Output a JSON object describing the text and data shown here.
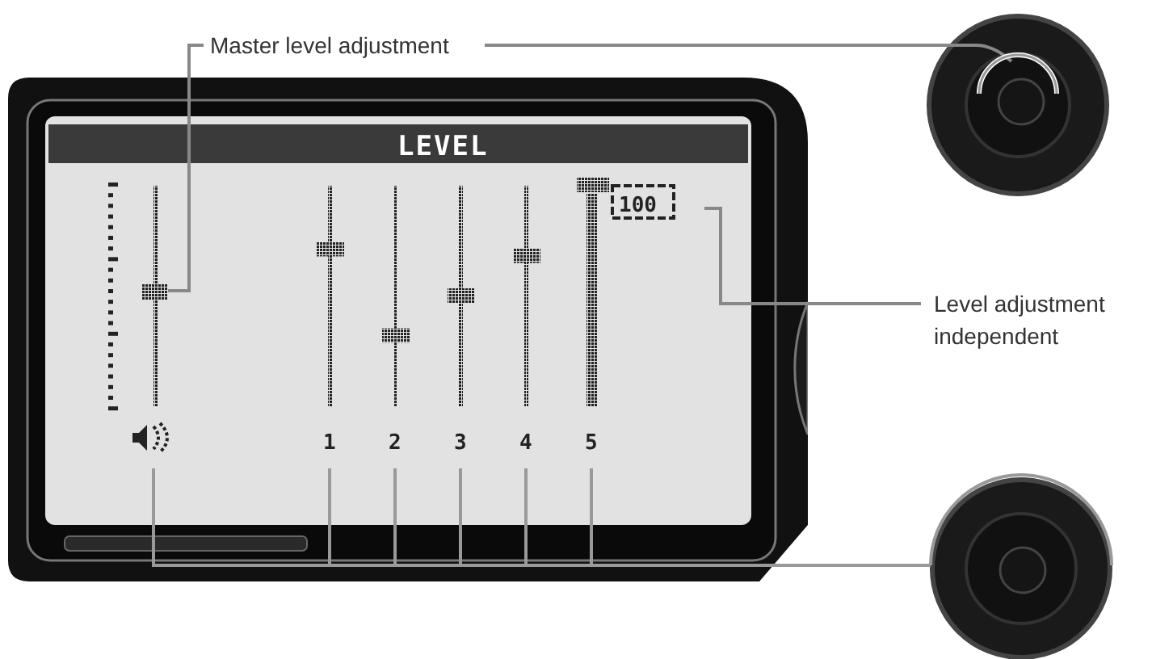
{
  "screen": {
    "title": "LEVEL"
  },
  "master": {
    "level": 0.52
  },
  "channels": [
    {
      "label": "1",
      "level": 0.71,
      "selected": false
    },
    {
      "label": "2",
      "level": 0.32,
      "selected": false
    },
    {
      "label": "3",
      "level": 0.5,
      "selected": false
    },
    {
      "label": "4",
      "level": 0.68,
      "selected": false
    },
    {
      "label": "5",
      "level": 1,
      "selected": true,
      "reading": "100"
    }
  ],
  "callouts": {
    "master": "Master level adjustment",
    "independent": "Level adjustment independent"
  }
}
